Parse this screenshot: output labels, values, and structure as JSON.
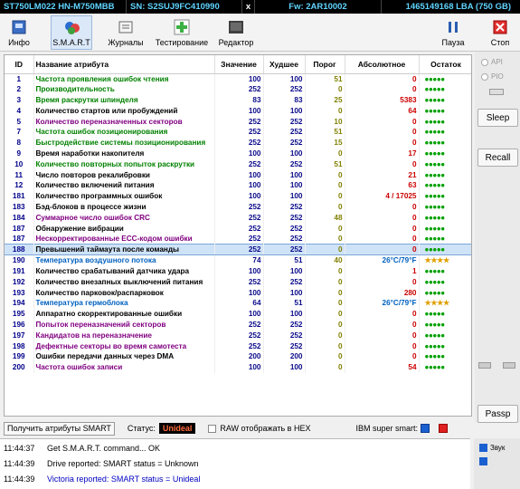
{
  "titlebar": {
    "model": "ST750LM022 HN-M750MBB",
    "serial": "SN: S2SUJ9FC410990",
    "close": "x",
    "firmware": "Fw: 2AR10002",
    "capacity": "1465149168 LBA (750 GB)"
  },
  "toolbar": {
    "items": [
      {
        "label": "Инфо",
        "icon": "info-icon"
      },
      {
        "label": "S.M.A.R.T",
        "icon": "smart-icon"
      },
      {
        "label": "Журналы",
        "icon": "journal-icon"
      },
      {
        "label": "Тестирование",
        "icon": "plus-icon"
      },
      {
        "label": "Редактор",
        "icon": "editor-icon"
      }
    ],
    "pause": "Пауза",
    "stop": "Стоп"
  },
  "table": {
    "headers": [
      "ID",
      "Название атрибута",
      "Значение",
      "Худшее",
      "Порог",
      "Абсолютное",
      "Остаток"
    ],
    "rows": [
      {
        "id": "1",
        "name": "Частота проявления ошибок чтения",
        "val": "100",
        "worst": "100",
        "thr": "51",
        "abs": "0",
        "rest": "●●●●●",
        "nc": "#008000",
        "ac": "#cc0000",
        "rc": "#00a000"
      },
      {
        "id": "2",
        "name": "Производительность",
        "val": "252",
        "worst": "252",
        "thr": "0",
        "abs": "0",
        "rest": "●●●●●",
        "nc": "#008000",
        "ac": "#cc0000",
        "rc": "#00a000"
      },
      {
        "id": "3",
        "name": "Время раскрутки шпинделя",
        "val": "83",
        "worst": "83",
        "thr": "25",
        "abs": "5383",
        "rest": "●●●●●",
        "nc": "#008000",
        "ac": "#cc0000",
        "rc": "#00a000"
      },
      {
        "id": "4",
        "name": "Количество стартов или пробуждений",
        "val": "100",
        "worst": "100",
        "thr": "0",
        "abs": "64",
        "rest": "●●●●●",
        "nc": "#000000",
        "ac": "#cc0000",
        "rc": "#00a000"
      },
      {
        "id": "5",
        "name": "Количество переназначенных секторов",
        "val": "252",
        "worst": "252",
        "thr": "10",
        "abs": "0",
        "rest": "●●●●●",
        "nc": "#800080",
        "ac": "#cc0000",
        "rc": "#00a000"
      },
      {
        "id": "7",
        "name": "Частота ошибок позиционирования",
        "val": "252",
        "worst": "252",
        "thr": "51",
        "abs": "0",
        "rest": "●●●●●",
        "nc": "#008000",
        "ac": "#cc0000",
        "rc": "#00a000"
      },
      {
        "id": "8",
        "name": "Быстродействие системы позиционирования",
        "val": "252",
        "worst": "252",
        "thr": "15",
        "abs": "0",
        "rest": "●●●●●",
        "nc": "#008000",
        "ac": "#cc0000",
        "rc": "#00a000"
      },
      {
        "id": "9",
        "name": "Время наработки накопителя",
        "val": "100",
        "worst": "100",
        "thr": "0",
        "abs": "17",
        "rest": "●●●●●",
        "nc": "#000000",
        "ac": "#cc0000",
        "rc": "#00a000"
      },
      {
        "id": "10",
        "name": "Количество повторных попыток раскрутки",
        "val": "252",
        "worst": "252",
        "thr": "51",
        "abs": "0",
        "rest": "●●●●●",
        "nc": "#008000",
        "ac": "#cc0000",
        "rc": "#00a000"
      },
      {
        "id": "11",
        "name": "Число повторов рекалибровки",
        "val": "100",
        "worst": "100",
        "thr": "0",
        "abs": "21",
        "rest": "●●●●●",
        "nc": "#000000",
        "ac": "#cc0000",
        "rc": "#00a000"
      },
      {
        "id": "12",
        "name": "Количество включений питания",
        "val": "100",
        "worst": "100",
        "thr": "0",
        "abs": "63",
        "rest": "●●●●●",
        "nc": "#000000",
        "ac": "#cc0000",
        "rc": "#00a000"
      },
      {
        "id": "181",
        "name": "Количество программных ошибок",
        "val": "100",
        "worst": "100",
        "thr": "0",
        "abs": "4 / 17025",
        "rest": "●●●●●",
        "nc": "#000000",
        "ac": "#cc0000",
        "rc": "#00a000"
      },
      {
        "id": "183",
        "name": "Бэд-блоков в процессе жизни",
        "val": "252",
        "worst": "252",
        "thr": "0",
        "abs": "0",
        "rest": "●●●●●",
        "nc": "#000000",
        "ac": "#cc0000",
        "rc": "#00a000"
      },
      {
        "id": "184",
        "name": "Суммарное число ошибок CRC",
        "val": "252",
        "worst": "252",
        "thr": "48",
        "abs": "0",
        "rest": "●●●●●",
        "nc": "#800080",
        "ac": "#cc0000",
        "rc": "#00a000"
      },
      {
        "id": "187",
        "name": "Обнаружение вибрации",
        "val": "252",
        "worst": "252",
        "thr": "0",
        "abs": "0",
        "rest": "●●●●●",
        "nc": "#000000",
        "ac": "#cc0000",
        "rc": "#00a000"
      },
      {
        "id": "187",
        "name": "Нескорректированные ECC-кодом ошибки",
        "val": "252",
        "worst": "252",
        "thr": "0",
        "abs": "0",
        "rest": "●●●●●",
        "nc": "#800080",
        "ac": "#cc0000",
        "rc": "#00a000"
      },
      {
        "id": "188",
        "name": "Превышений таймаута после команды",
        "val": "252",
        "worst": "252",
        "thr": "0",
        "abs": "0",
        "rest": "●●●●●",
        "nc": "#000000",
        "ac": "#cc0000",
        "rc": "#00a000",
        "sel": true
      },
      {
        "id": "190",
        "name": "Температура воздушного потока",
        "val": "74",
        "worst": "51",
        "thr": "40",
        "abs": "26°C/79°F",
        "rest": "★★★★",
        "nc": "#0060c0",
        "ac": "#0060c0",
        "rc": "#e0a000"
      },
      {
        "id": "191",
        "name": "Количество срабатываний датчика удара",
        "val": "100",
        "worst": "100",
        "thr": "0",
        "abs": "1",
        "rest": "●●●●●",
        "nc": "#000000",
        "ac": "#cc0000",
        "rc": "#00a000"
      },
      {
        "id": "192",
        "name": "Количество внезапных выключений питания",
        "val": "252",
        "worst": "252",
        "thr": "0",
        "abs": "0",
        "rest": "●●●●●",
        "nc": "#000000",
        "ac": "#cc0000",
        "rc": "#00a000"
      },
      {
        "id": "193",
        "name": "Количество парковок/распарковок",
        "val": "100",
        "worst": "100",
        "thr": "0",
        "abs": "280",
        "rest": "●●●●●",
        "nc": "#000000",
        "ac": "#cc0000",
        "rc": "#00a000"
      },
      {
        "id": "194",
        "name": "Температура гермоблока",
        "val": "64",
        "worst": "51",
        "thr": "0",
        "abs": "26°C/79°F",
        "rest": "★★★★",
        "nc": "#0060c0",
        "ac": "#0060c0",
        "rc": "#e0a000"
      },
      {
        "id": "195",
        "name": "Аппаратно скорректированные ошибки",
        "val": "100",
        "worst": "100",
        "thr": "0",
        "abs": "0",
        "rest": "●●●●●",
        "nc": "#000000",
        "ac": "#cc0000",
        "rc": "#00a000"
      },
      {
        "id": "196",
        "name": "Попыток переназначений секторов",
        "val": "252",
        "worst": "252",
        "thr": "0",
        "abs": "0",
        "rest": "●●●●●",
        "nc": "#800080",
        "ac": "#cc0000",
        "rc": "#00a000"
      },
      {
        "id": "197",
        "name": "Кандидатов на переназначение",
        "val": "252",
        "worst": "252",
        "thr": "0",
        "abs": "0",
        "rest": "●●●●●",
        "nc": "#800080",
        "ac": "#cc0000",
        "rc": "#00a000"
      },
      {
        "id": "198",
        "name": "Дефектные секторы во время самотеста",
        "val": "252",
        "worst": "252",
        "thr": "0",
        "abs": "0",
        "rest": "●●●●●",
        "nc": "#800080",
        "ac": "#cc0000",
        "rc": "#00a000"
      },
      {
        "id": "199",
        "name": "Ошибки передачи данных через DMA",
        "val": "200",
        "worst": "200",
        "thr": "0",
        "abs": "0",
        "rest": "●●●●●",
        "nc": "#000000",
        "ac": "#cc0000",
        "rc": "#00a000"
      },
      {
        "id": "200",
        "name": "Частота ошибок записи",
        "val": "100",
        "worst": "100",
        "thr": "0",
        "abs": "54",
        "rest": "●●●●●",
        "nc": "#800080",
        "ac": "#cc0000",
        "rc": "#00a000"
      }
    ]
  },
  "right": {
    "api": "API",
    "pio": "PIO",
    "sleep": "Sleep",
    "recall": "Recall",
    "passp": "Passp"
  },
  "status": {
    "get_button": "Получить атрибуты SMART",
    "status_label": "Статус:",
    "status_value": "Unideal",
    "raw_hex": "RAW отображать в HEX",
    "ibm": "IBM super smart:"
  },
  "log": [
    {
      "time": "11:44:37",
      "text": "Get S.M.A.R.T. command... OK",
      "color": "#000000"
    },
    {
      "time": "11:44:39",
      "text": "Drive reported: SMART status = Unknown",
      "color": "#000000"
    },
    {
      "time": "11:44:39",
      "text": "Victoria reported: SMART status = Unideal",
      "color": "#0000c0"
    }
  ],
  "bottom_right": {
    "sound": "Звук"
  }
}
